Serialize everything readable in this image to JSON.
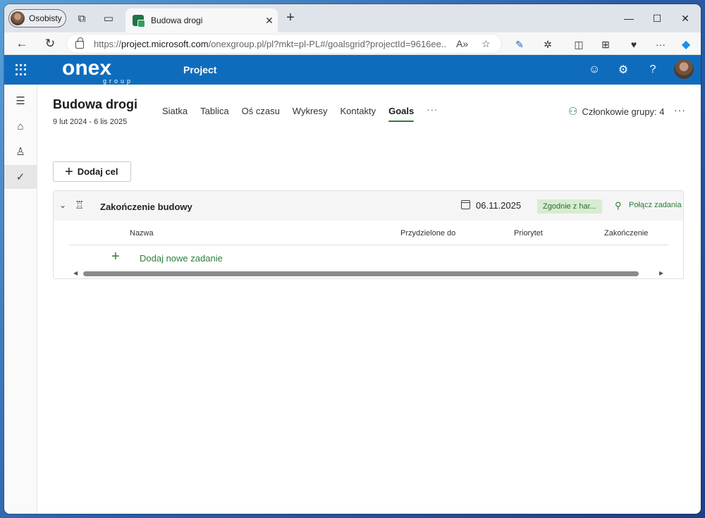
{
  "browser": {
    "profile_label": "Osobisty",
    "tab_title": "Budowa drogi",
    "url_prefix": "https://",
    "url_host": "project.microsoft.com",
    "url_path": "/onexgroup.pl/pl?mkt=pl-PL#/goalsgrid?projectId=9616ee..."
  },
  "app": {
    "brand_color": "#0f6cbd",
    "accent_color": "#2d7d3a",
    "logo_text": "onex",
    "logo_sub": "group",
    "title": "Project"
  },
  "project": {
    "name": "Budowa drogi",
    "dates": "9 lut 2024 - 6 lis 2025",
    "tabs": [
      {
        "label": "Siatka"
      },
      {
        "label": "Tablica"
      },
      {
        "label": "Oś czasu"
      },
      {
        "label": "Wykresy"
      },
      {
        "label": "Kontakty"
      },
      {
        "label": "Goals"
      }
    ],
    "active_tab": "Goals",
    "more_tabs": "···",
    "members_label": "Członkowie grupy: 4"
  },
  "goals": {
    "add_goal_label": "Dodaj cel",
    "goal": {
      "name": "Zakończenie budowy",
      "date": "06.11.2025",
      "status": "Zgodnie z har...",
      "connect_label": "Połącz zadania"
    },
    "columns": [
      "Nazwa",
      "Przydzielone do",
      "Priorytet",
      "Zakończenie"
    ],
    "add_task_label": "Dodaj nowe zadanie"
  },
  "icons": {
    "rail": [
      "hamburger-icon",
      "home-icon",
      "person-icon",
      "check-icon"
    ],
    "header": [
      "smiley-icon",
      "gear-icon",
      "help-icon"
    ]
  }
}
